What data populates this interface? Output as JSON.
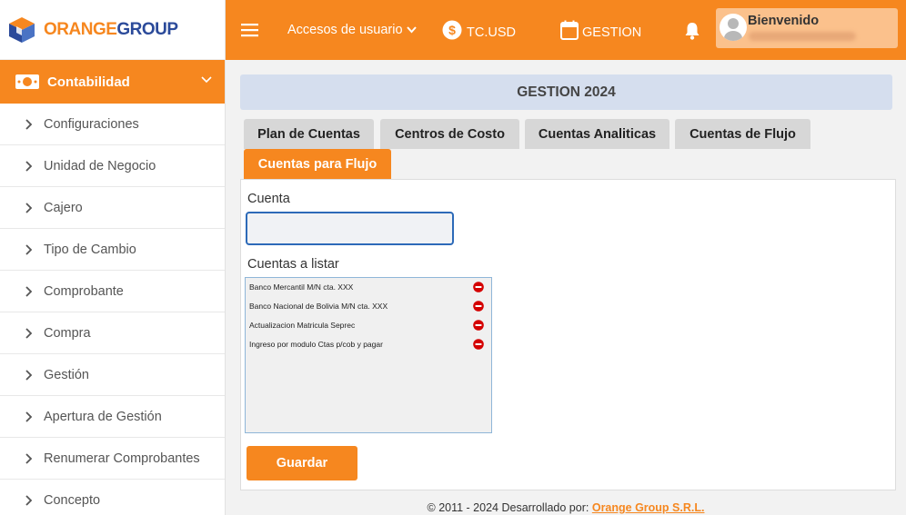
{
  "brand": {
    "name_part1": "ORANGE",
    "name_part2": "GROUP",
    "orange": "#f6871f",
    "blue": "#2b4a9a"
  },
  "sidebar": {
    "section": {
      "label": "Contabilidad",
      "icon": "money-icon"
    },
    "items": [
      {
        "label": "Configuraciones"
      },
      {
        "label": "Unidad de Negocio"
      },
      {
        "label": "Cajero"
      },
      {
        "label": "Tipo de Cambio"
      },
      {
        "label": "Comprobante"
      },
      {
        "label": "Compra"
      },
      {
        "label": "Gestión"
      },
      {
        "label": "Apertura de Gestión"
      },
      {
        "label": "Renumerar Comprobantes"
      },
      {
        "label": "Concepto"
      }
    ]
  },
  "topbar": {
    "access_label": "Accesos de usuario",
    "tc_label": "TC.USD",
    "gestion_label": "GESTION",
    "welcome": "Bienvenido"
  },
  "main": {
    "title": "GESTION 2024",
    "tabs": [
      {
        "label": "Plan de Cuentas"
      },
      {
        "label": "Centros de Costo"
      },
      {
        "label": "Cuentas Analiticas"
      },
      {
        "label": "Cuentas de Flujo"
      },
      {
        "label": "Cuentas para Flujo",
        "active": true
      }
    ],
    "cuenta_label": "Cuenta",
    "cuenta_value": "",
    "list_label": "Cuentas a listar",
    "list_items": [
      "Banco Mercantil M/N cta. XXX",
      "Banco Nacional de Bolivia M/N cta. XXX",
      "Actualizacion Matricula Seprec",
      "Ingreso por modulo Ctas p/cob y pagar"
    ],
    "save_label": "Guardar"
  },
  "footer": {
    "text": "© 2011 - 2024 Desarrollado por:",
    "link": "Orange Group S.R.L."
  }
}
